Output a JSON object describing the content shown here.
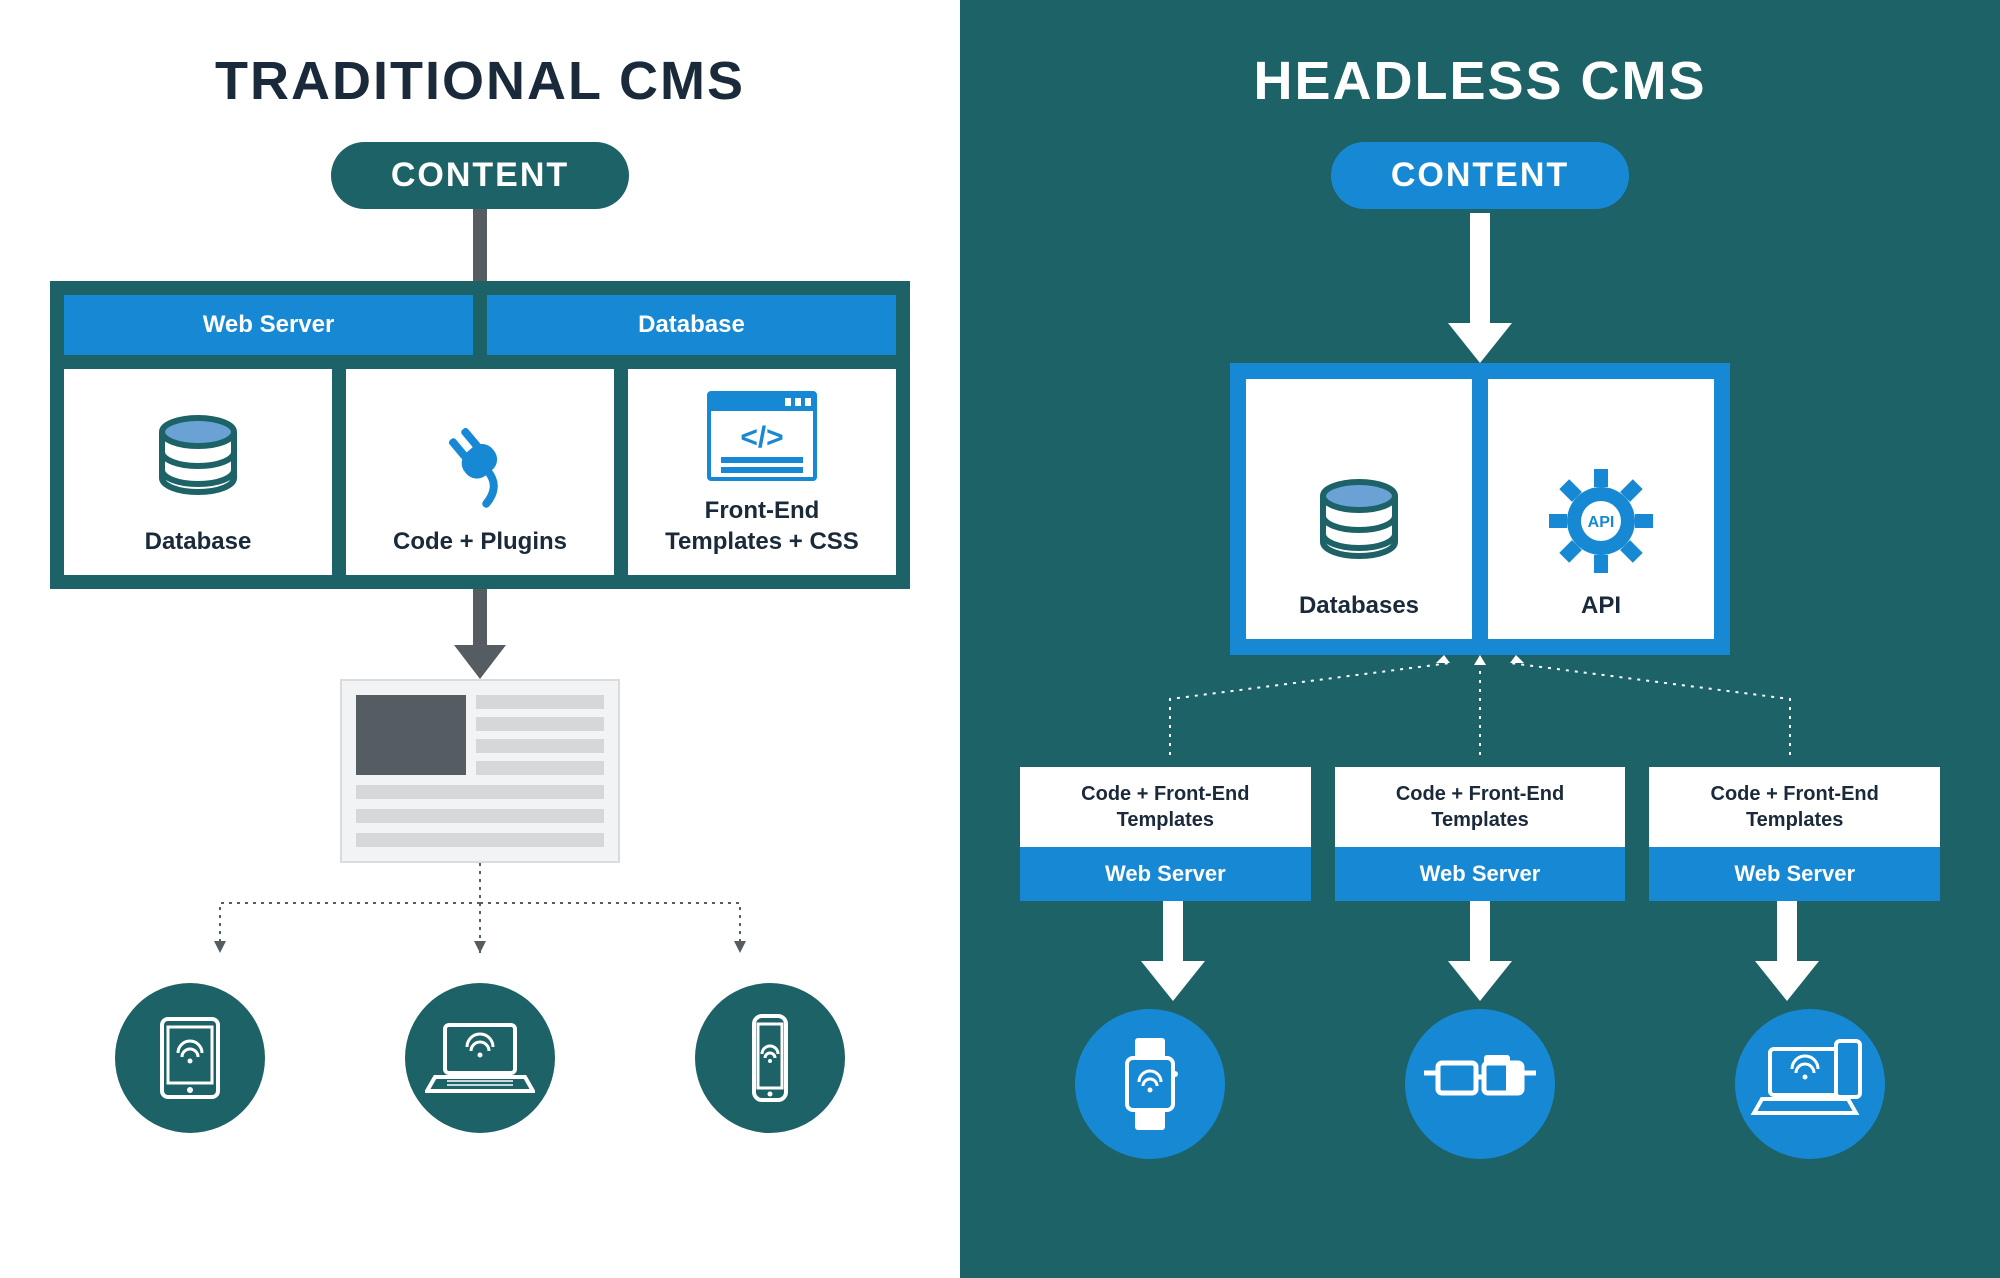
{
  "left": {
    "title": "TRADITIONAL CMS",
    "content_label": "CONTENT",
    "headers": {
      "a": "Web Server",
      "b": "Database"
    },
    "cards": {
      "db": "Database",
      "plugins": "Code + Plugins",
      "templates": "Front-End\nTemplates + CSS"
    },
    "devices": [
      "tablet",
      "laptop",
      "phone"
    ]
  },
  "right": {
    "title": "HEADLESS CMS",
    "content_label": "CONTENT",
    "cards": {
      "db": "Databases",
      "api": "API"
    },
    "server_top": "Code + Front-End\nTemplates",
    "server_bottom": "Web Server",
    "devices": [
      "smartwatch",
      "smart-glasses",
      "laptop"
    ]
  },
  "colors": {
    "teal": "#1d6267",
    "blue": "#1789d4",
    "gray": "#555d62"
  }
}
